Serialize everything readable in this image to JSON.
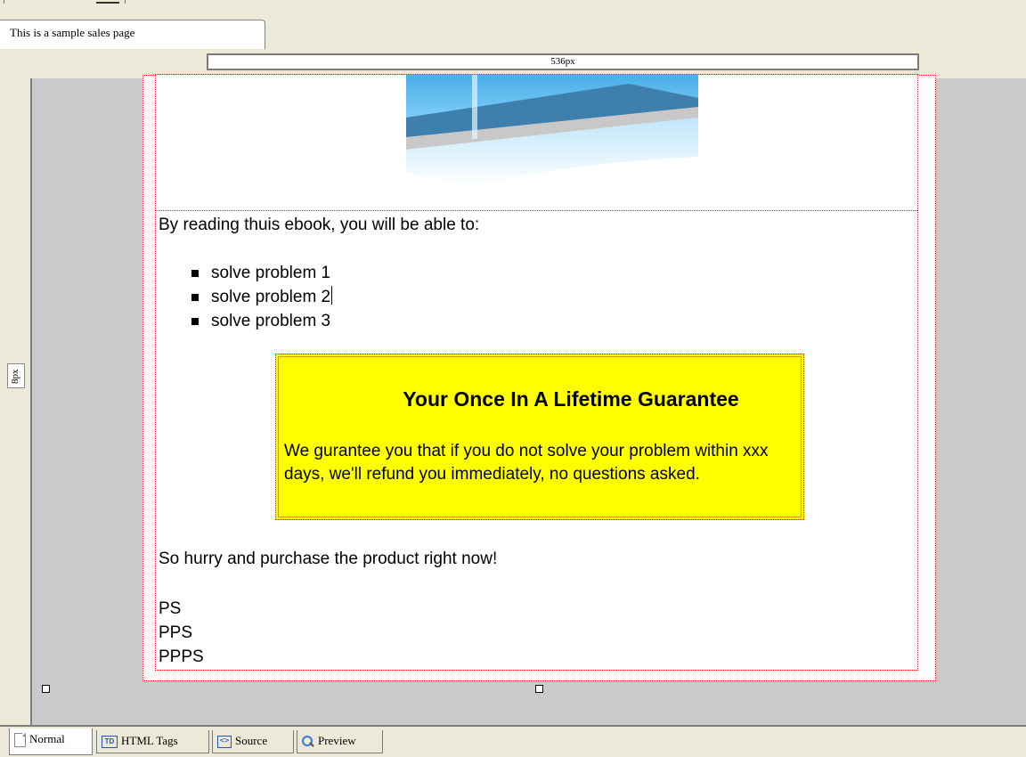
{
  "document_tab": {
    "title": "This is a sample sales page"
  },
  "rulers": {
    "width_label": "536px",
    "height_label": "8px"
  },
  "page": {
    "intro": "By reading thuis ebook, you will be able to:",
    "bullets": [
      "solve problem 1",
      "solve problem 2",
      "solve problem 3"
    ],
    "guarantee": {
      "title": "Your Once In A Lifetime Guarantee",
      "body": "We gurantee you that if you do not solve your problem within xxx days, we'll refund you immediately, no questions asked."
    },
    "closing": "So hurry and purchase the product right now!",
    "ps_lines": [
      "PS",
      "PPS",
      "PPPS"
    ]
  },
  "view_tabs": [
    {
      "label": "Normal",
      "icon": "document-icon",
      "active": true
    },
    {
      "label": "HTML Tags",
      "icon": "td-tag-icon",
      "active": false
    },
    {
      "label": "Source",
      "icon": "source-code-icon",
      "active": false
    },
    {
      "label": "Preview",
      "icon": "magnifier-icon",
      "active": false
    }
  ],
  "colors": {
    "chrome": "#ece9d8",
    "canvas": "#cacaca",
    "guide_border": "#e02020",
    "guarantee_fill": "#ffff00",
    "image_blue": "#5bbcf5"
  }
}
